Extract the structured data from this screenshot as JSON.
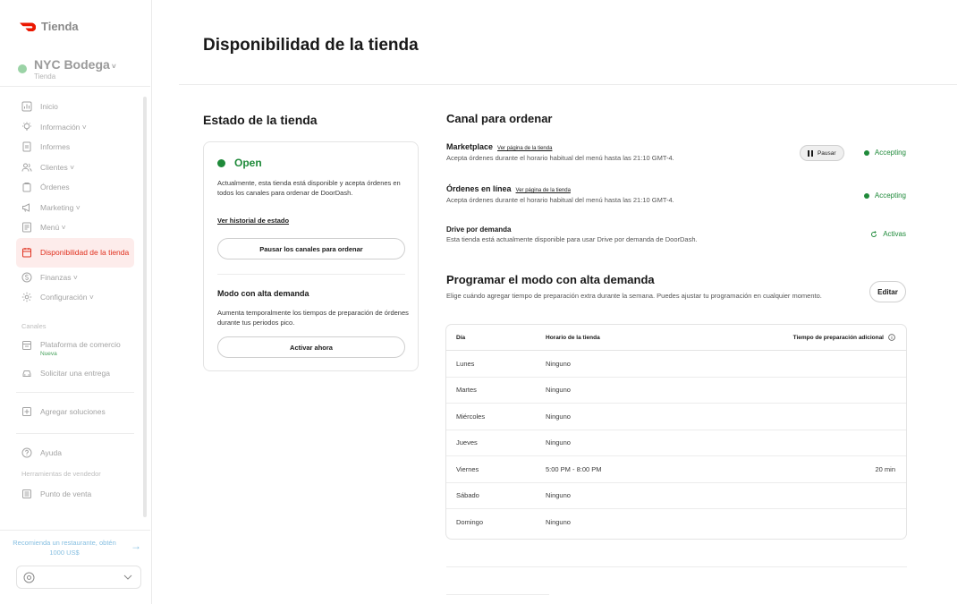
{
  "brand": {
    "name": "Tienda"
  },
  "store": {
    "name": "NYC Bodega",
    "sub": "Tienda"
  },
  "sidebar": {
    "items": [
      {
        "label": "Inicio"
      },
      {
        "label": "Información"
      },
      {
        "label": "Informes"
      },
      {
        "label": "Clientes"
      },
      {
        "label": "Órdenes"
      },
      {
        "label": "Marketing"
      },
      {
        "label": "Menú"
      },
      {
        "label": "Disponibilidad de la tienda"
      },
      {
        "label": "Finanzas"
      },
      {
        "label": "Configuración"
      }
    ],
    "channels_label": "Canales",
    "channels": [
      {
        "label": "Plataforma de comercio",
        "badge": "Nueva"
      },
      {
        "label": "Solicitar una entrega"
      }
    ],
    "add_solutions": "Agregar soluciones",
    "help": "Ayuda",
    "tools_label": "Herramientas de vendedor",
    "pos": "Punto de venta",
    "promo": "Recomienda un restaurante, obtén 1000 US$"
  },
  "page": {
    "title": "Disponibilidad de la tienda"
  },
  "store_status": {
    "title": "Estado de la tienda",
    "status": "Open",
    "desc": "Actualmente, esta tienda está disponible y acepta órdenes en todos los canales para ordenar de DoorDash.",
    "history_link": "Ver historial de estado",
    "pause_all": "Pausar los canales para ordenar",
    "busy_title": "Modo con alta demanda",
    "busy_desc": "Aumenta temporalmente los tiempos de preparación de órdenes durante tus periodos pico.",
    "activate": "Activar ahora"
  },
  "channels": {
    "title": "Canal para ordenar",
    "marketplace": {
      "title": "Marketplace",
      "link": "Ver página de la tienda",
      "desc": "Acepta órdenes durante el horario habitual del menú hasta las 21:10 GMT-4.",
      "pause": "Pausar",
      "status": "Accepting"
    },
    "online": {
      "title": "Órdenes en línea",
      "link": "Ver página de la tienda",
      "desc": "Acepta órdenes durante el horario habitual del menú hasta las 21:10 GMT-4.",
      "status": "Accepting"
    },
    "drive": {
      "title": "Drive por demanda",
      "desc": "Esta tienda está actualmente disponible para usar Drive por demanda de DoorDash.",
      "status": "Activas"
    }
  },
  "schedule": {
    "title": "Programar el modo con alta demanda",
    "desc": "Elige cuándo agregar tiempo de preparación extra durante la semana. Puedes ajustar tu programación en cualquier momento.",
    "edit": "Editar",
    "headers": {
      "day": "Día",
      "hours": "Horario de la tienda",
      "extra": "Tiempo de preparación adicional"
    },
    "rows": [
      {
        "day": "Lunes",
        "hours": "Ninguno",
        "extra": ""
      },
      {
        "day": "Martes",
        "hours": "Ninguno",
        "extra": ""
      },
      {
        "day": "Miércoles",
        "hours": "Ninguno",
        "extra": ""
      },
      {
        "day": "Jueves",
        "hours": "Ninguno",
        "extra": ""
      },
      {
        "day": "Viernes",
        "hours": "5:00 PM - 8:00 PM",
        "extra": "20 min"
      },
      {
        "day": "Sábado",
        "hours": "Ninguno",
        "extra": ""
      },
      {
        "day": "Domingo",
        "hours": "Ninguno",
        "extra": ""
      }
    ]
  },
  "colors": {
    "accent_red": "#e0301e",
    "green": "#1f8a3a"
  }
}
